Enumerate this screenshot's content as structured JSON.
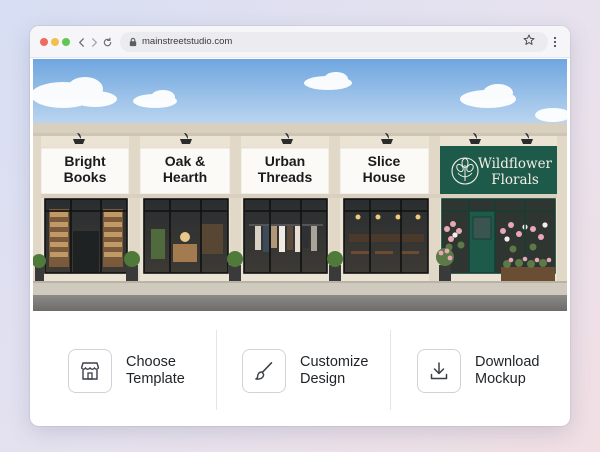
{
  "browser": {
    "url": "mainstreetstudio.com",
    "traffic_lights": [
      "close",
      "minimize",
      "maximize"
    ],
    "icons": [
      "back-icon",
      "forward-icon",
      "reload-icon",
      "lock-icon",
      "bookmark-star-icon",
      "menu-icon"
    ]
  },
  "colors": {
    "sky_top": "#7fb0e4",
    "facade": "#ece4d6",
    "sign_bg": "#fbfaf7",
    "florals_sign": "#1e5a4a",
    "text_dark": "#1f2328"
  },
  "storefronts": [
    {
      "line1": "Bright",
      "line2": "Books"
    },
    {
      "line1": "Oak &",
      "line2": "Hearth"
    },
    {
      "line1": "Urban",
      "line2": "Threads"
    },
    {
      "line1": "Slice",
      "line2": "House"
    },
    {
      "line1": "Wildflower",
      "line2": "Florals"
    }
  ],
  "tools": [
    {
      "line1": "Choose",
      "line2": "Template",
      "icon": "storefront-icon"
    },
    {
      "line1": "Customize",
      "line2": "Design",
      "icon": "paintbrush-icon"
    },
    {
      "line1": "Download",
      "line2": "Mockup",
      "icon": "download-icon"
    }
  ]
}
